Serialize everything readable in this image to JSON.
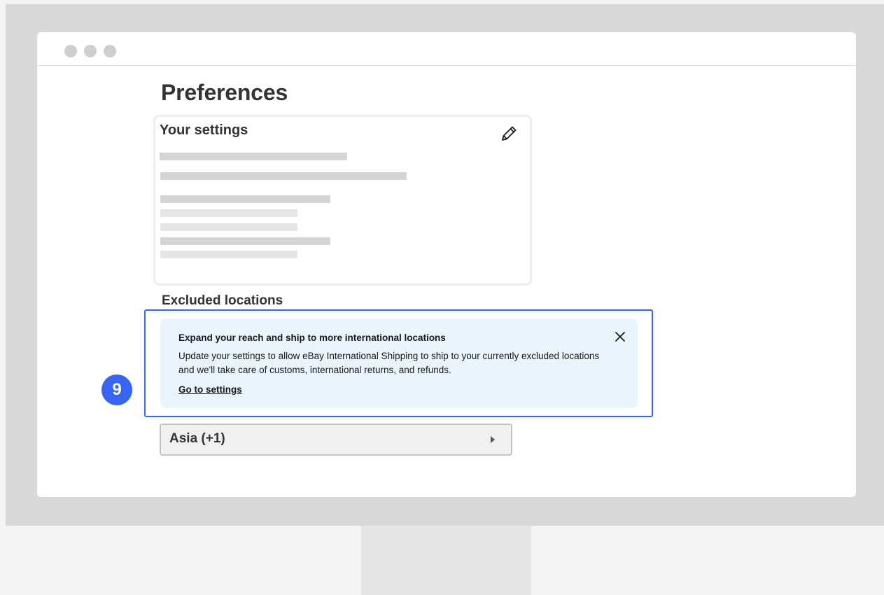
{
  "page": {
    "title": "Preferences"
  },
  "settings_card": {
    "title": "Your settings",
    "edit_icon": "pencil-icon"
  },
  "excluded_locations": {
    "heading": "Excluded locations",
    "notice": {
      "title": "Expand your reach and ship to more international locations",
      "body": "Update your settings to allow eBay International Shipping to ship to your currently excluded locations and we'll take care of customs, international returns, and refunds.",
      "link_label": "Go to settings",
      "close_icon": "close-icon"
    },
    "region_label": "Asia (+1)",
    "region_icon": "chevron-right-icon"
  },
  "callout_number": "9",
  "colors": {
    "accent": "#3665f3",
    "notice_bg": "#e9f4fd",
    "monitor_frame": "#d8d8d8",
    "placeholder_bar": "#d5d5d5"
  }
}
